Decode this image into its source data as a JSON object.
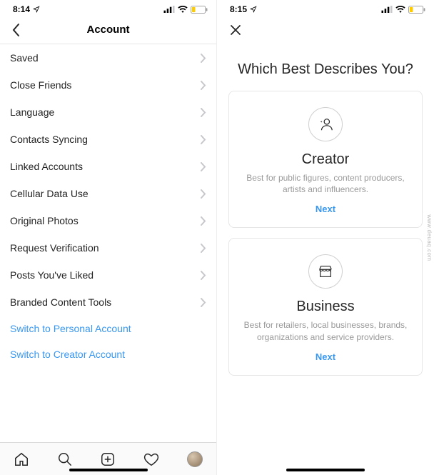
{
  "left": {
    "status": {
      "time": "8:14",
      "location_arrow": true
    },
    "header": {
      "title": "Account"
    },
    "rows": [
      {
        "label": "Saved"
      },
      {
        "label": "Close Friends"
      },
      {
        "label": "Language"
      },
      {
        "label": "Contacts Syncing"
      },
      {
        "label": "Linked Accounts"
      },
      {
        "label": "Cellular Data Use"
      },
      {
        "label": "Original Photos"
      },
      {
        "label": "Request Verification"
      },
      {
        "label": "Posts You've Liked"
      },
      {
        "label": "Branded Content Tools"
      }
    ],
    "links": [
      {
        "label": "Switch to Personal Account"
      },
      {
        "label": "Switch to Creator Account"
      }
    ]
  },
  "right": {
    "status": {
      "time": "8:15",
      "location_arrow": true
    },
    "headline": "Which Best Describes You?",
    "cards": [
      {
        "icon": "creator-icon",
        "title": "Creator",
        "desc": "Best for public figures, content producers, artists and influencers.",
        "next": "Next"
      },
      {
        "icon": "business-icon",
        "title": "Business",
        "desc": "Best for retailers, local businesses, brands, organizations and service providers.",
        "next": "Next"
      }
    ]
  },
  "watermark": "www.deuaq.com"
}
